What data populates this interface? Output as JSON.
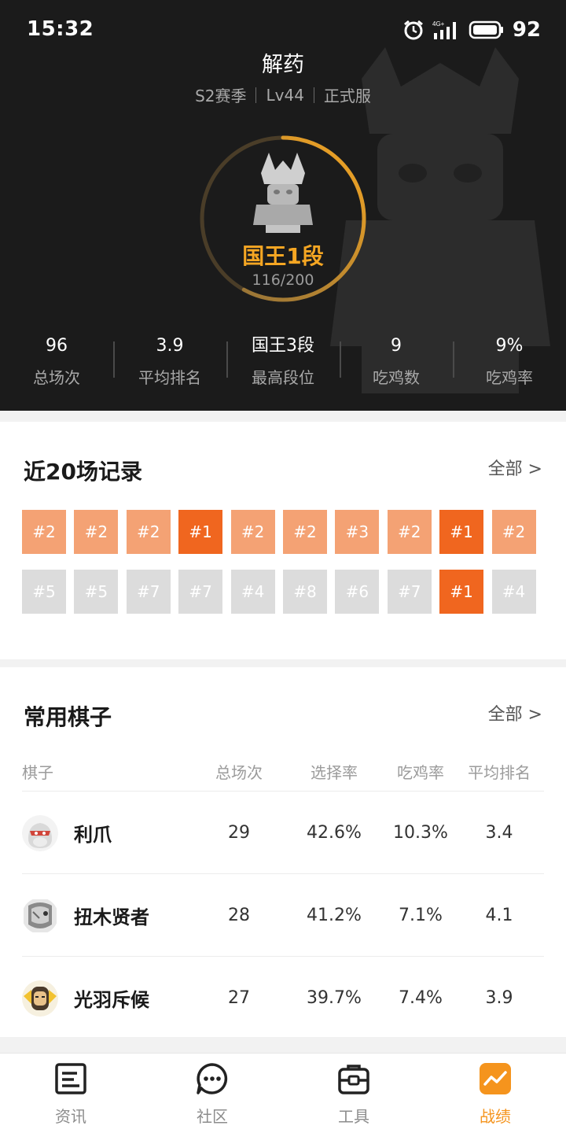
{
  "status": {
    "time": "15:32",
    "network": "4G+",
    "battery": "92"
  },
  "profile": {
    "name": "解药",
    "season": "S2赛季",
    "level": "Lv44",
    "server": "正式服",
    "rank": "国王1段",
    "rank_progress_text": "116/200",
    "rank_progress_fraction": 0.58
  },
  "stats": [
    {
      "value": "96",
      "label": "总场次"
    },
    {
      "value": "3.9",
      "label": "平均排名"
    },
    {
      "value": "国王3段",
      "label": "最高段位"
    },
    {
      "value": "9",
      "label": "吃鸡数"
    },
    {
      "value": "9%",
      "label": "吃鸡率"
    }
  ],
  "recent": {
    "title": "近20场记录",
    "more": "全部 >",
    "matches": [
      "#2",
      "#2",
      "#2",
      "#1",
      "#2",
      "#2",
      "#3",
      "#2",
      "#1",
      "#2",
      "#5",
      "#5",
      "#7",
      "#7",
      "#4",
      "#8",
      "#6",
      "#7",
      "#1",
      "#4"
    ]
  },
  "pieces": {
    "title": "常用棋子",
    "more": "全部 >",
    "headers": [
      "棋子",
      "总场次",
      "选择率",
      "吃鸡率",
      "平均排名"
    ],
    "rows": [
      {
        "name": "利爪",
        "games": "29",
        "pick": "42.6%",
        "win": "10.3%",
        "avg": "3.4",
        "icon": "claw-avatar"
      },
      {
        "name": "扭木贤者",
        "games": "28",
        "pick": "41.2%",
        "win": "7.1%",
        "avg": "4.1",
        "icon": "sage-avatar"
      },
      {
        "name": "光羽斥候",
        "games": "27",
        "pick": "39.7%",
        "win": "7.4%",
        "avg": "3.9",
        "icon": "scout-avatar"
      }
    ]
  },
  "tabs": [
    {
      "label": "资讯",
      "icon": "news-icon",
      "active": false
    },
    {
      "label": "社区",
      "icon": "chat-icon",
      "active": false
    },
    {
      "label": "工具",
      "icon": "toolbox-icon",
      "active": false
    },
    {
      "label": "战绩",
      "icon": "stats-chart-icon",
      "active": true
    }
  ],
  "colors": {
    "accent": "#f5a623",
    "top1": "#f0661f",
    "top_half": "#f4a274",
    "low": "#dcdcdc",
    "tab_active": "#f5941d"
  }
}
